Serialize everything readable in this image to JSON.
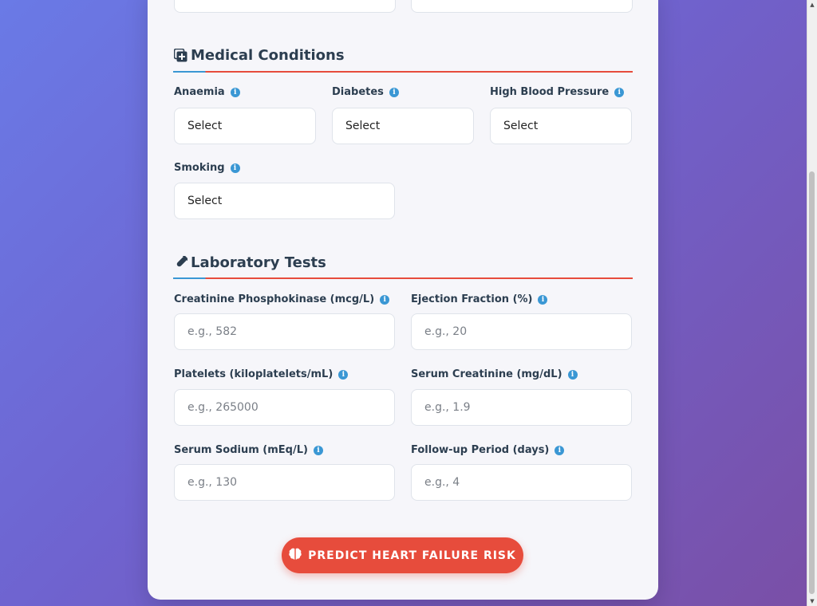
{
  "medical_conditions": {
    "title": "Medical Conditions",
    "icon": "notes-medical-icon",
    "fields": {
      "anaemia": {
        "label": "Anaemia",
        "value": "Select"
      },
      "diabetes": {
        "label": "Diabetes",
        "value": "Select"
      },
      "high_bp": {
        "label": "High Blood Pressure",
        "value": "Select"
      },
      "smoking": {
        "label": "Smoking",
        "value": "Select"
      }
    }
  },
  "laboratory_tests": {
    "title": "Laboratory Tests",
    "icon": "vial-icon",
    "fields": {
      "cpk": {
        "label": "Creatinine Phosphokinase (mcg/L)",
        "placeholder": "e.g., 582"
      },
      "ejection": {
        "label": "Ejection Fraction (%)",
        "placeholder": "e.g., 20"
      },
      "platelets": {
        "label": "Platelets (kiloplatelets/mL)",
        "placeholder": "e.g., 265000"
      },
      "creatinine": {
        "label": "Serum Creatinine (mg/dL)",
        "placeholder": "e.g., 1.9"
      },
      "sodium": {
        "label": "Serum Sodium (mEq/L)",
        "placeholder": "e.g., 130"
      },
      "followup": {
        "label": "Follow-up Period (days)",
        "placeholder": "e.g., 4"
      }
    }
  },
  "submit": {
    "label": "PREDICT HEART FAILURE RISK",
    "icon": "brain-icon"
  },
  "colors": {
    "accent_red": "#e74c3c",
    "accent_blue": "#3a97d4",
    "text_dark": "#2c3e50"
  }
}
